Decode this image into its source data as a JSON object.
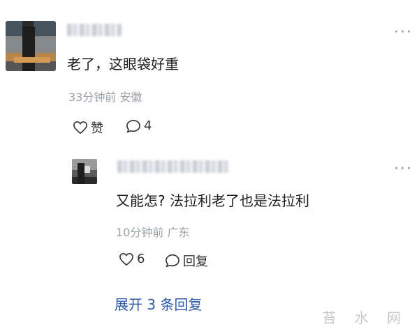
{
  "comment1": {
    "text": "老了，这眼袋好重",
    "meta": "33分钟前 安徽",
    "like_label": "赞",
    "reply_count": "4",
    "more": "···"
  },
  "comment2": {
    "text": "又能怎?  法拉利老了也是法拉利",
    "meta": "10分钟前 广东",
    "like_count": "6",
    "reply_label": "回复",
    "more": "···"
  },
  "expand_label": "展开 3 条回复",
  "watermark": "苔 水 网",
  "colors": {
    "link": "#2f5aa8",
    "meta": "#9aa0a6",
    "icon": "#333333"
  },
  "icons": [
    "heart-outline-icon",
    "comment-bubble-icon",
    "more-dots-icon"
  ]
}
